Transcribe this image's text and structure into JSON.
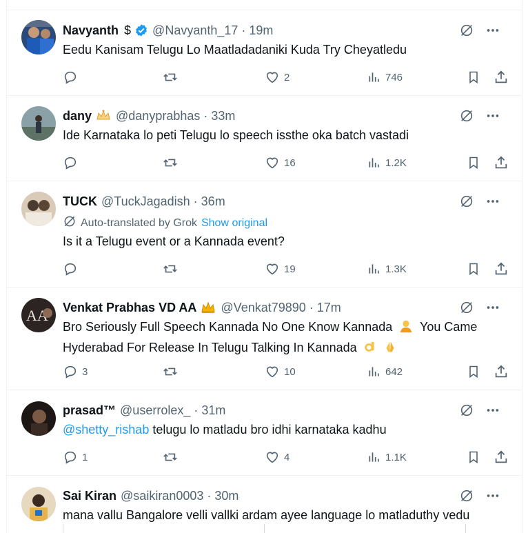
{
  "colors": {
    "accent": "#1d9bf0",
    "secondary_text": "#536471",
    "border": "#eff3f4",
    "verified": "#1d9bf0",
    "crown": "#f4b400"
  },
  "tweets": [
    {
      "name": "Navyanth",
      "name_suffix": "$",
      "verified": true,
      "handle": "@Navyanth_17",
      "time": "19m",
      "text": "Eedu Kanisam Telugu Lo Maatladadaniki Kuda Try Cheyatledu",
      "replies": "",
      "reposts": "",
      "likes": "2",
      "views": "746"
    },
    {
      "name": "dany",
      "name_emoji": "crown-outline",
      "handle": "@danyprabhas",
      "time": "33m",
      "text": "Ide Karnataka lo peti Telugu lo speech issthe oka batch vastadi",
      "replies": "",
      "reposts": "",
      "likes": "16",
      "views": "1.2K"
    },
    {
      "name": "TUCK",
      "handle": "@TuckJagadish",
      "time": "36m",
      "translated_label": "Auto-translated by Grok",
      "show_original": "Show original",
      "text": "Is it a Telugu event or a Kannada event?",
      "replies": "",
      "reposts": "",
      "likes": "19",
      "views": "1.3K"
    },
    {
      "name": "Venkat Prabhas VD AA",
      "name_emoji": "crown",
      "handle": "@Venkat79890",
      "time": "17m",
      "text_line1": "Bro Seriously Full Speech Kannada No One Know Kannada",
      "text_line1_after": "You Came",
      "text_line2": "Hyderabad For Release In Telugu Talking In Kannada",
      "replies": "3",
      "reposts": "",
      "likes": "10",
      "views": "642"
    },
    {
      "name": "prasad™",
      "handle": "@userrolex_",
      "time": "31m",
      "mention": "@shetty_rishab",
      "text": "telugu lo matladu bro idhi karnataka kadhu",
      "replies": "1",
      "reposts": "",
      "likes": "4",
      "views": "1.1K"
    },
    {
      "name": "Sai Kiran",
      "handle": "@saikiran0003",
      "time": "30m",
      "text": "mana vallu Bangalore velli vallki ardam ayee language lo matladuthy vedu"
    }
  ],
  "dot": "·"
}
